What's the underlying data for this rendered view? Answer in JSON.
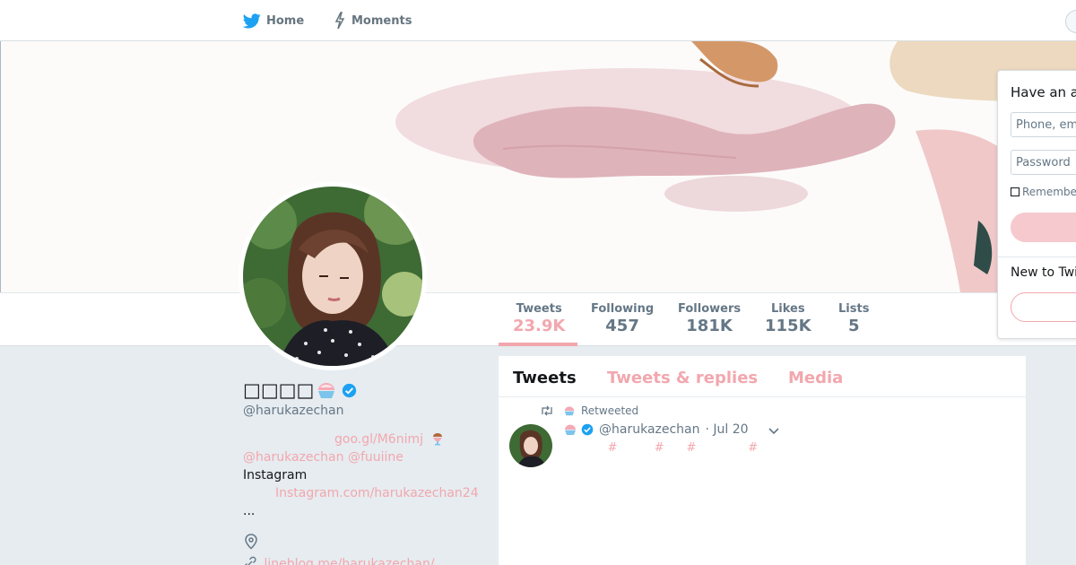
{
  "nav": {
    "home_label": "Home",
    "moments_label": "Moments"
  },
  "profile": {
    "name": "□□□□",
    "handle": "@harukazechan",
    "bio_link": "goo.gl/M6nimj",
    "bio_mentions": "@harukazechan @fuuiine",
    "bio_instagram_label": "Instagram",
    "bio_instagram_link": "Instagram.com/harukazechan24",
    "bio_ellipsis": "...",
    "website": "lineblog.me/harukazechan/"
  },
  "stats": [
    {
      "label": "Tweets",
      "value": "23.9K"
    },
    {
      "label": "Following",
      "value": "457"
    },
    {
      "label": "Followers",
      "value": "181K"
    },
    {
      "label": "Likes",
      "value": "115K"
    },
    {
      "label": "Lists",
      "value": "5"
    }
  ],
  "tabs": {
    "tweets": "Tweets",
    "replies": "Tweets & replies",
    "media": "Media"
  },
  "tweet": {
    "retweeted_label": "Retweeted",
    "handle": "@harukazechan",
    "date": "· Jul 20",
    "body": "            #          #      #              #"
  },
  "login": {
    "title": "Have an account?",
    "phone_placeholder": "Phone, email or username",
    "password_placeholder": "Password",
    "remember_label": "Remember me",
    "new_label": "New to Twitter?"
  },
  "colors": {
    "accent": "#f2a7ae",
    "verified": "#1da1f2",
    "brand_bird": "#1da1f2"
  },
  "icons": {
    "home": "twitter-bird-icon",
    "moments": "lightning-icon",
    "location": "location-pin-icon",
    "link": "link-icon",
    "retweet": "retweet-icon",
    "verified": "verified-badge-icon",
    "caret": "chevron-down-icon"
  }
}
